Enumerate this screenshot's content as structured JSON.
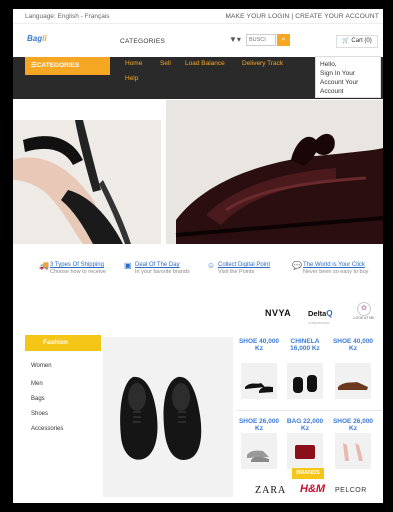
{
  "topbar": {
    "language": "Language: English - Français",
    "account": "MAKE YOUR LOGIN | CREATE YOUR ACCOUNT"
  },
  "header": {
    "logo_main": "Bag",
    "logo_accent": "li",
    "categories_link": "CATEGORIES",
    "filter_glyph": "▼▾",
    "search_placeholder": "BUSCI",
    "cart_label": "Cart (0)"
  },
  "nav": {
    "categories_button": "CATEGORIES",
    "items": [
      "Home",
      "Sell",
      "Load Balance",
      "Delivery Track",
      "Help"
    ]
  },
  "account_dropdown": [
    "Hello,",
    "Sign In Your",
    "Account Your",
    "Account"
  ],
  "features": [
    {
      "title": "3 Types Of Shipping",
      "subtitle": "Choose how to receive"
    },
    {
      "title": "Deal Of The Day",
      "subtitle": "In your favorite brands"
    },
    {
      "title": "Collect Digital Point",
      "subtitle": "Visit the Points"
    },
    {
      "title": "The World is Your Click",
      "subtitle": "Never been so easy to buy"
    }
  ],
  "brands_top": {
    "nvya": "NVYA",
    "delta": "Delta",
    "delta_sub": "CORPORATE",
    "look": "LOOK AT ME"
  },
  "side_menu": {
    "title": "Fashion",
    "items": [
      "Women",
      "Men",
      "Bags",
      "Shoes",
      "Accessories"
    ]
  },
  "products": [
    {
      "title": "SHOE 40,000 Kz"
    },
    {
      "title": "CHINELA 16,000 Kz"
    },
    {
      "title": "SHOE 40,000 Kz"
    },
    {
      "title": "SHOE 26,000 Kz"
    },
    {
      "title": "BAG 22,000 Kz"
    },
    {
      "title": "SHOE 26,000 Kz"
    }
  ],
  "brands_bottom": {
    "label": "BRANDS",
    "zara": "ZARA",
    "hm": "H&M",
    "pelcor": "PELCOR"
  },
  "colors": {
    "accent": "#f5a623",
    "link": "#2d6cc4",
    "dark": "#2a2a2a",
    "yellow": "#f5c518"
  }
}
